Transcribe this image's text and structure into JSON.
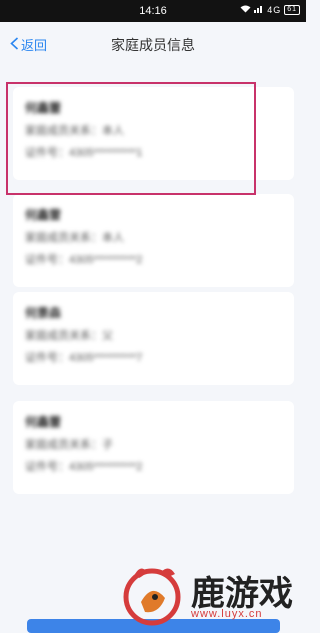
{
  "status_bar": {
    "time": "14:16",
    "network": "4G",
    "battery": "61"
  },
  "nav": {
    "back_label": "返回",
    "title": "家庭成员信息"
  },
  "members": [
    {
      "name": "何鑫蕾",
      "relation": "家庭成员关系：本人",
      "id": "证件号：4305**********1"
    },
    {
      "name": "何鑫雷",
      "relation": "家庭成员关系：本人",
      "id": "证件号：4305**********2"
    },
    {
      "name": "何景森",
      "relation": "家庭成员关系：父",
      "id": "证件号：4305**********7"
    },
    {
      "name": "何鑫蕾",
      "relation": "家庭成员关系：子",
      "id": "证件号：4305**********2"
    }
  ],
  "watermark": {
    "text": "鹿游戏",
    "url": "www.luyx.cn"
  },
  "colors": {
    "accent": "#2a86f0",
    "highlight": "#c8326a",
    "button": "#3d84e8"
  }
}
